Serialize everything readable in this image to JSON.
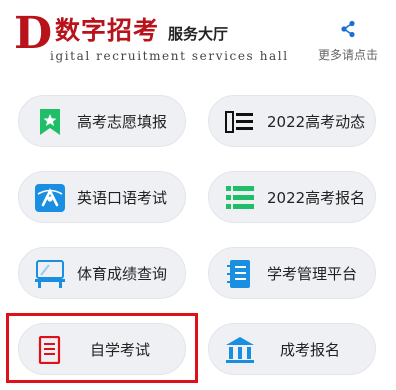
{
  "header": {
    "logo_letter": "D",
    "logo_title": "数字招考",
    "logo_subtitle": "服务大厅",
    "logo_english": "igital recruitment services hall",
    "share_label": "更多请点击",
    "share_icon": "share-icon"
  },
  "colors": {
    "brand_red": "#b8121a",
    "tile_bg": "#eef0f3",
    "green": "#1fbf6a",
    "blue": "#1a8ee0",
    "highlight": "#e0101a"
  },
  "menu": {
    "items": [
      {
        "label": "高考志愿填报",
        "icon": "star-bookmark-icon"
      },
      {
        "label": "2022高考动态",
        "icon": "news-list-icon"
      },
      {
        "label": "英语口语考试",
        "icon": "english-speech-icon"
      },
      {
        "label": "2022高考报名",
        "icon": "list-icon"
      },
      {
        "label": "体育成绩查询",
        "icon": "sports-icon"
      },
      {
        "label": "学考管理平台",
        "icon": "notebook-icon"
      },
      {
        "label": "自学考试",
        "icon": "document-icon",
        "selected": true
      },
      {
        "label": "成考报名",
        "icon": "institution-icon"
      }
    ]
  }
}
